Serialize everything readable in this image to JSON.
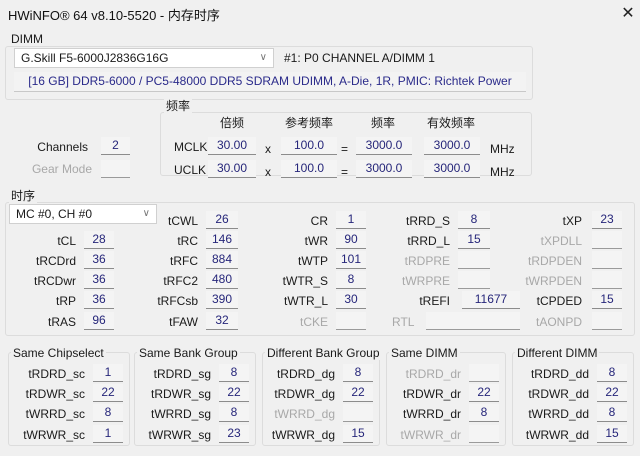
{
  "window": {
    "title": "HWiNFO® 64 v8.10-5520 - 内存时序",
    "close_icon": "close-icon"
  },
  "dimm": {
    "group_label": "DIMM",
    "selected_module": "G.Skill F5-6000J2836G16G",
    "slot": "#1: P0 CHANNEL A/DIMM 1",
    "info": "[16 GB] DDR5-6000 / PC5-48000 DDR5 SDRAM UDIMM, A-Die, 1R, PMIC: Richtek Power"
  },
  "channels": {
    "label": "Channels",
    "value": "2",
    "gear_label": "Gear Mode",
    "gear_value": ""
  },
  "frequency": {
    "group_label": "频率",
    "headers": [
      "倍频",
      "参考频率",
      "频率",
      "有效频率"
    ],
    "rows": [
      {
        "label": "MCLK",
        "multiplier": "30.00",
        "times": "x",
        "ref": "100.0",
        "equals": "=",
        "freq": "3000.0",
        "effective": "3000.0",
        "unit": "MHz"
      },
      {
        "label": "UCLK",
        "multiplier": "30.00",
        "times": "x",
        "ref": "100.0",
        "equals": "=",
        "freq": "3000.0",
        "effective": "3000.0",
        "unit": "MHz"
      }
    ]
  },
  "timings": {
    "group_label": "时序",
    "selected_channel": "MC #0, CH #0",
    "items": [
      {
        "label": "tCL",
        "value": "28"
      },
      {
        "label": "tRCDrd",
        "value": "36"
      },
      {
        "label": "tRCDwr",
        "value": "36"
      },
      {
        "label": "tRP",
        "value": "36"
      },
      {
        "label": "tRAS",
        "value": "96"
      },
      {
        "label": "tCWL",
        "value": "26"
      },
      {
        "label": "tRC",
        "value": "146"
      },
      {
        "label": "tRFC",
        "value": "884"
      },
      {
        "label": "tRFC2",
        "value": "480"
      },
      {
        "label": "tRFCsb",
        "value": "390"
      },
      {
        "label": "tFAW",
        "value": "32"
      },
      {
        "label": "CR",
        "value": "1"
      },
      {
        "label": "tWR",
        "value": "90"
      },
      {
        "label": "tWTP",
        "value": "101"
      },
      {
        "label": "tWTR_S",
        "value": "8"
      },
      {
        "label": "tWTR_L",
        "value": "30"
      },
      {
        "label": "tCKE",
        "value": "",
        "disabled": true
      },
      {
        "label": "tRRD_S",
        "value": "8"
      },
      {
        "label": "tRRD_L",
        "value": "15"
      },
      {
        "label": "tRDPRE",
        "value": "",
        "disabled": true
      },
      {
        "label": "tWRPRE",
        "value": "",
        "disabled": true
      },
      {
        "label": "tREFI",
        "value": "11677"
      },
      {
        "label": "RTL",
        "value": "",
        "disabled": true
      },
      {
        "label": "tXP",
        "value": "23"
      },
      {
        "label": "tXPDLL",
        "value": "",
        "disabled": true
      },
      {
        "label": "tRDPDEN",
        "value": "",
        "disabled": true
      },
      {
        "label": "tWRPDEN",
        "value": "",
        "disabled": true
      },
      {
        "label": "tCPDED",
        "value": "15"
      },
      {
        "label": "tAONPD",
        "value": "",
        "disabled": true
      }
    ]
  },
  "turnaround": [
    {
      "title": "Same Chipselect",
      "items": [
        {
          "label": "tRDRD_sc",
          "value": "1"
        },
        {
          "label": "tRDWR_sc",
          "value": "22"
        },
        {
          "label": "tWRRD_sc",
          "value": "8"
        },
        {
          "label": "tWRWR_sc",
          "value": "1"
        }
      ]
    },
    {
      "title": "Same Bank Group",
      "items": [
        {
          "label": "tRDRD_sg",
          "value": "8"
        },
        {
          "label": "tRDWR_sg",
          "value": "22"
        },
        {
          "label": "tWRRD_sg",
          "value": "8"
        },
        {
          "label": "tWRWR_sg",
          "value": "23"
        }
      ]
    },
    {
      "title": "Different Bank Group",
      "items": [
        {
          "label": "tRDRD_dg",
          "value": "8"
        },
        {
          "label": "tRDWR_dg",
          "value": "22"
        },
        {
          "label": "tWRRD_dg",
          "value": "",
          "disabled": true
        },
        {
          "label": "tWRWR_dg",
          "value": "15"
        }
      ]
    },
    {
      "title": "Same DIMM",
      "items": [
        {
          "label": "tRDRD_dr",
          "value": "",
          "disabled": true
        },
        {
          "label": "tRDWR_dr",
          "value": "22"
        },
        {
          "label": "tWRRD_dr",
          "value": "8"
        },
        {
          "label": "tWRWR_dr",
          "value": "",
          "disabled": true
        }
      ]
    },
    {
      "title": "Different DIMM",
      "items": [
        {
          "label": "tRDRD_dd",
          "value": "8"
        },
        {
          "label": "tRDWR_dd",
          "value": "22"
        },
        {
          "label": "tWRRD_dd",
          "value": "8"
        },
        {
          "label": "tWRWR_dd",
          "value": "15"
        }
      ]
    }
  ]
}
